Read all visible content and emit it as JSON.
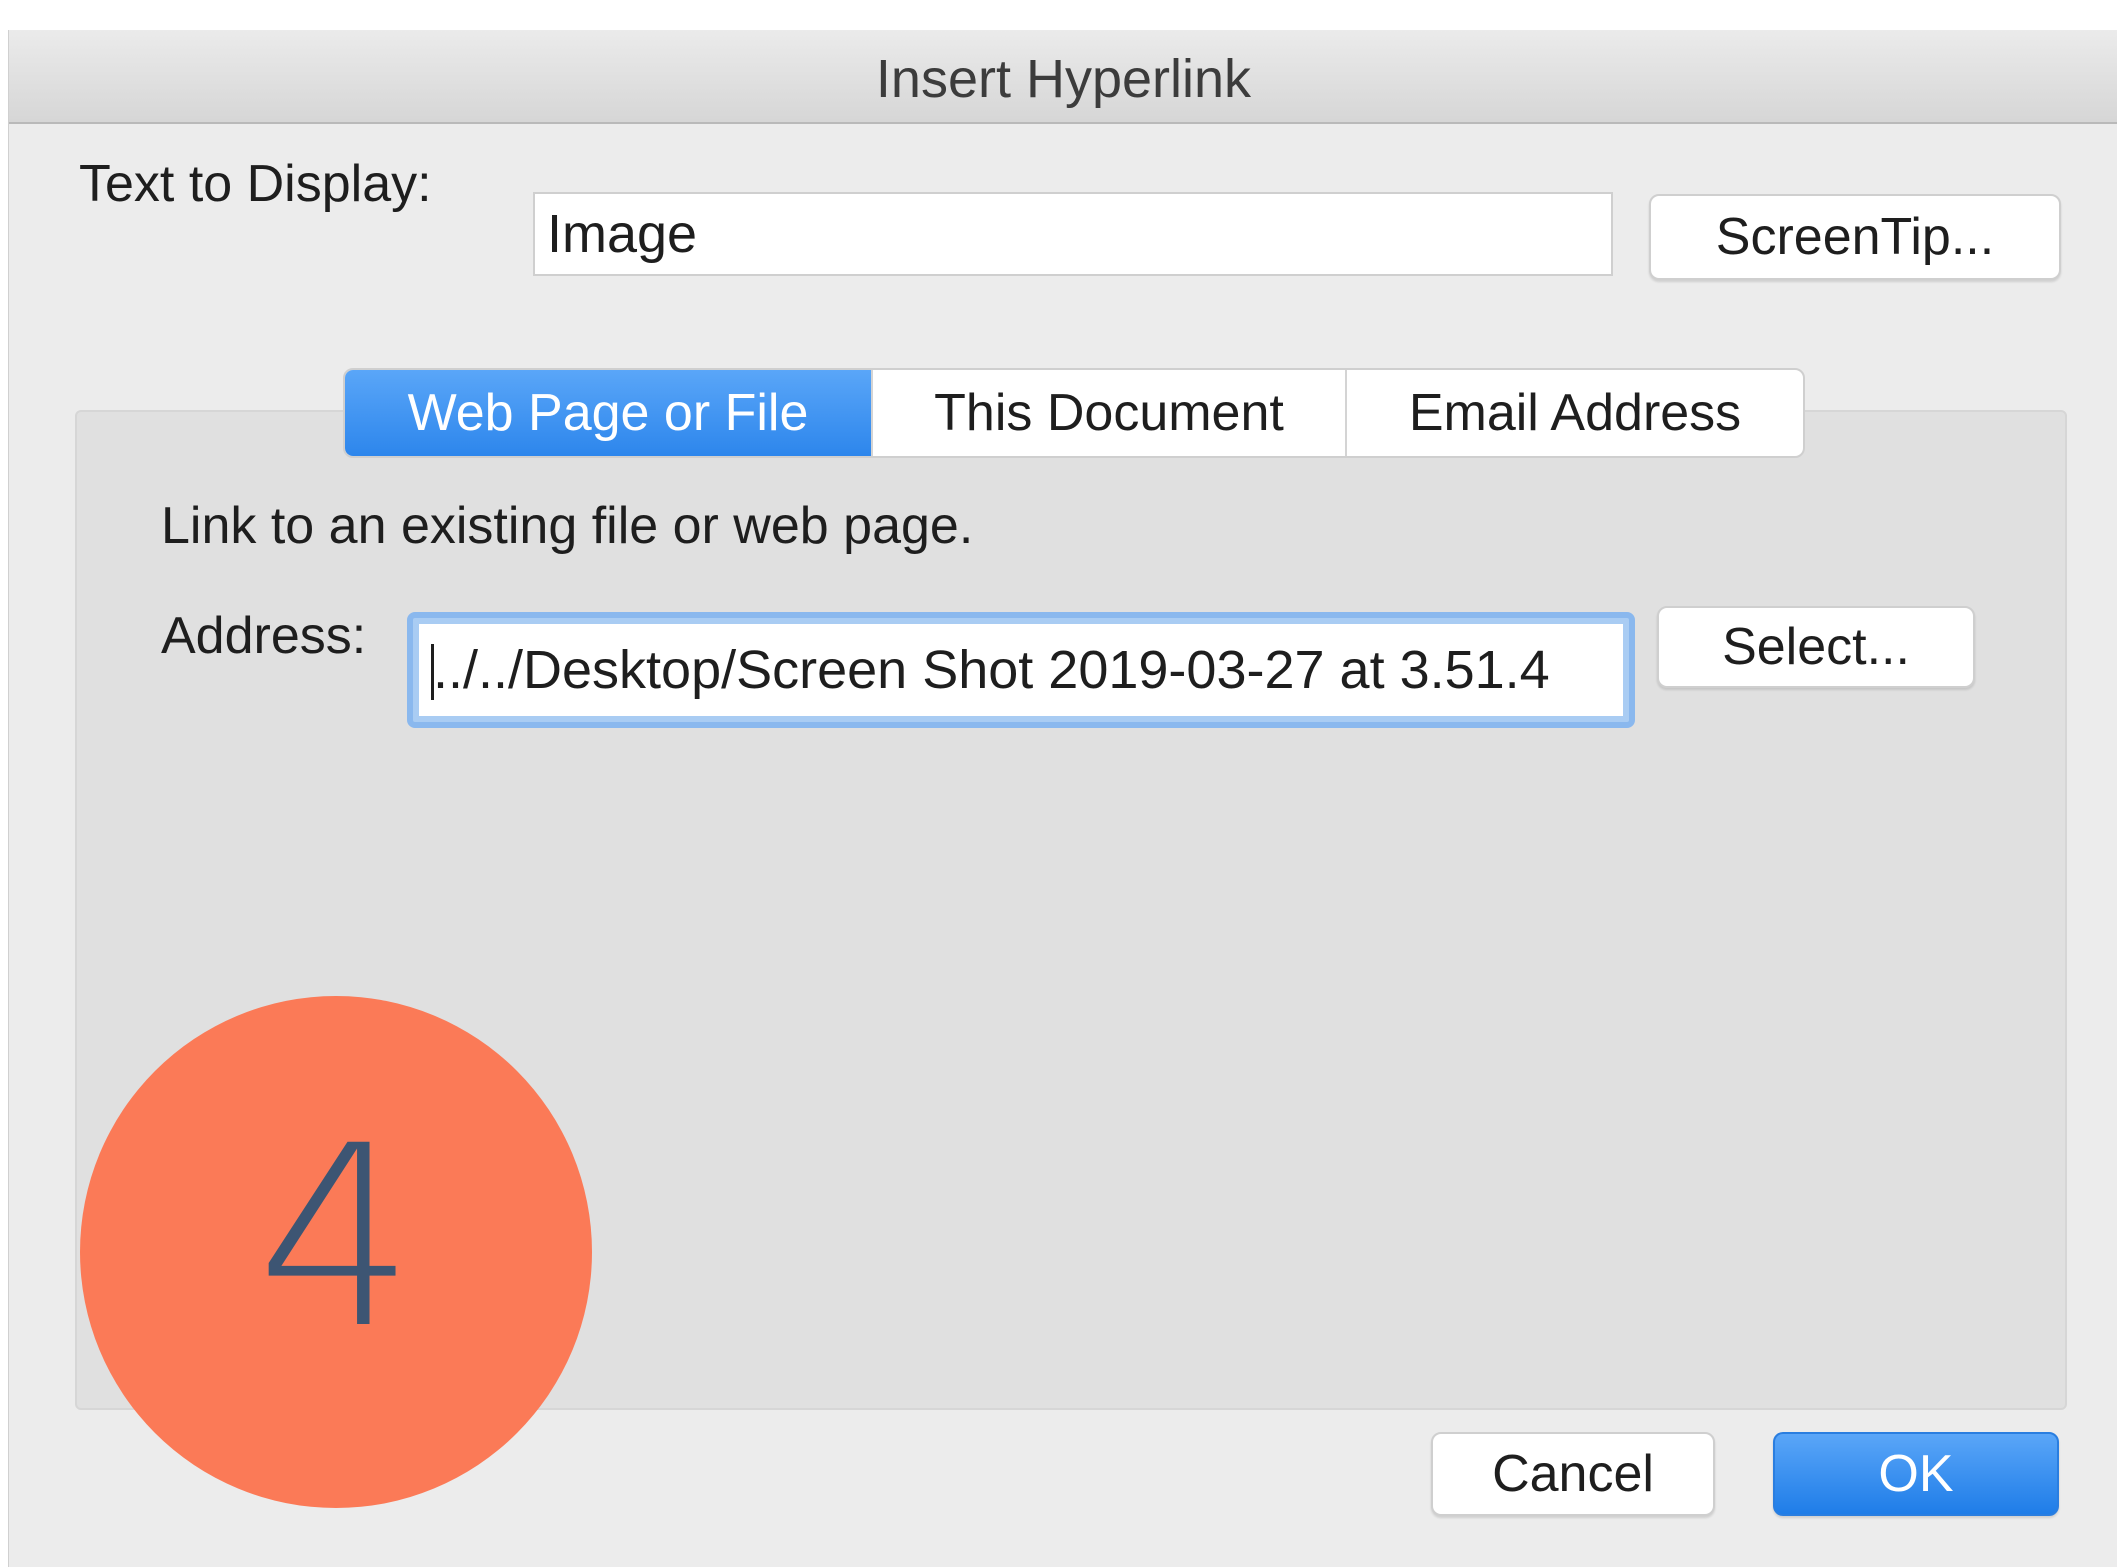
{
  "window": {
    "title": "Insert Hyperlink"
  },
  "display_text": {
    "label": "Text to Display:",
    "value": "Image",
    "screentip_button": "ScreenTip..."
  },
  "tabs": [
    {
      "label": "Web Page or File",
      "active": true
    },
    {
      "label": "This Document",
      "active": false
    },
    {
      "label": "Email Address",
      "active": false
    }
  ],
  "panel": {
    "description": "Link to an existing file or web page.",
    "address_label": "Address:",
    "address_value": "../../Desktop/Screen Shot 2019-03-27 at 3.51.4",
    "select_button": "Select..."
  },
  "footer": {
    "cancel_button": "Cancel",
    "ok_button": "OK"
  },
  "step_badge": {
    "number": "4",
    "color": "#fb7a57"
  },
  "colors": {
    "accent": "#2d86ec",
    "focus_ring": "#8ab8ee"
  }
}
